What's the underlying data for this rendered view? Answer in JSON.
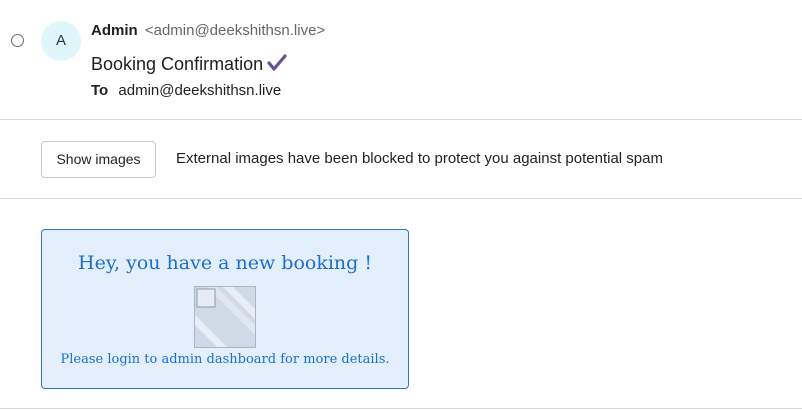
{
  "message": {
    "select_label": "Select message",
    "avatar_initial": "A",
    "sender_name": "Admin",
    "sender_email": "<admin@deekshithsn.live>",
    "subject": "Booking Confirmation",
    "to_label": "To",
    "to_address": "admin@deekshithsn.live"
  },
  "images_bar": {
    "button_label": "Show images",
    "notice": "External images have been blocked to protect you against potential spam"
  },
  "body": {
    "heading": "Hey, you have a new booking !",
    "image_icon": "broken-image-icon",
    "note": "Please login to admin dashboard for more details."
  },
  "colors": {
    "avatar_bg": "#dff7fb",
    "check_mark": "#6a4f9e",
    "card_bg": "#e3effd",
    "card_border": "#2f72c4",
    "card_text": "#1b6fd3"
  }
}
